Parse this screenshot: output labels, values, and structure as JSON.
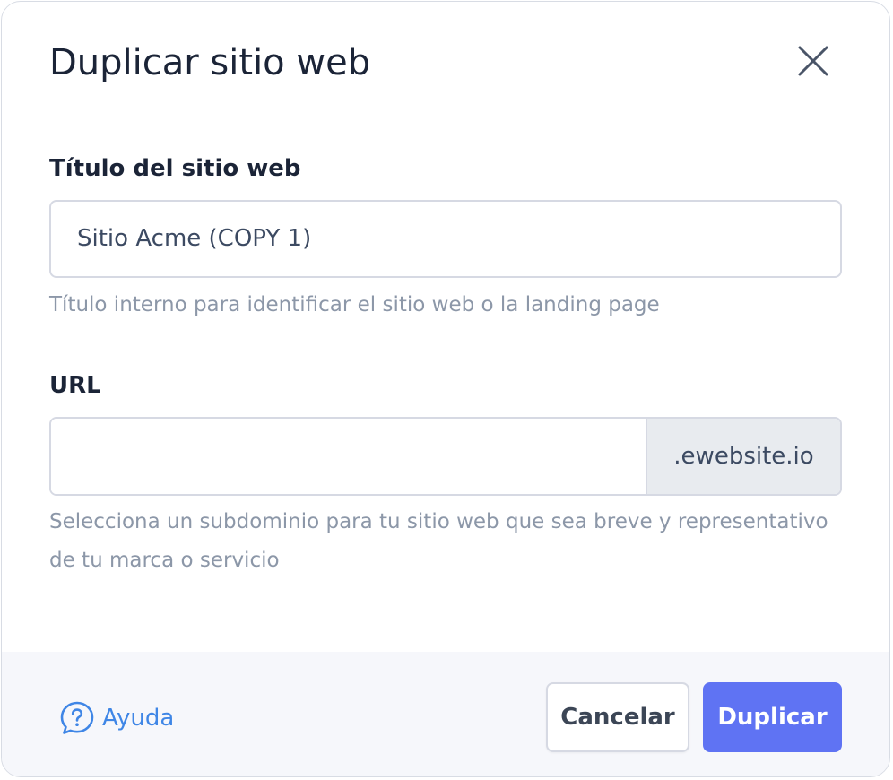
{
  "dialog": {
    "title": "Duplicar sitio web",
    "close_icon": "close-icon"
  },
  "fields": {
    "site_title": {
      "label": "Título del sitio web",
      "value": "Sitio Acme (COPY 1)",
      "helper": "Título interno para identificar el sitio web o la landing page"
    },
    "url": {
      "label": "URL",
      "value": "",
      "suffix": ".ewebsite.io",
      "helper": "Selecciona un subdominio para tu sitio web que sea breve y representativo de tu marca o servicio"
    }
  },
  "footer": {
    "help_label": "Ayuda",
    "help_icon": "question-bubble-icon",
    "cancel_label": "Cancelar",
    "submit_label": "Duplicar"
  },
  "colors": {
    "primary": "#5f73f3",
    "link": "#3f86e6",
    "text": "#1b2437",
    "muted": "#8c97a8"
  }
}
